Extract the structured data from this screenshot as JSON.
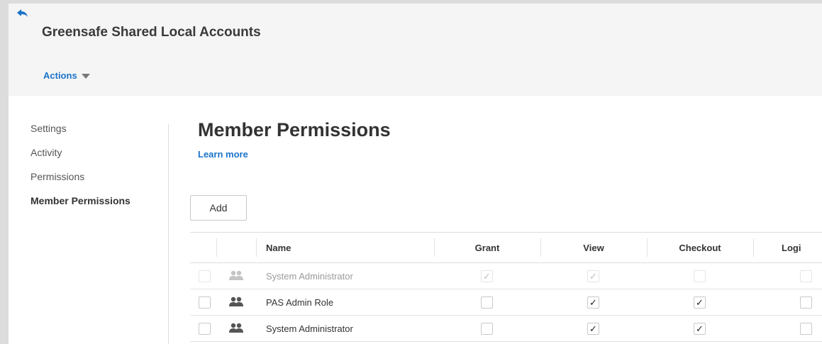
{
  "header": {
    "title": "Greensafe Shared Local Accounts",
    "actions_label": "Actions"
  },
  "sidebar": {
    "items": [
      {
        "label": "Settings",
        "active": false
      },
      {
        "label": "Activity",
        "active": false
      },
      {
        "label": "Permissions",
        "active": false
      },
      {
        "label": "Member Permissions",
        "active": true
      }
    ]
  },
  "main": {
    "title": "Member Permissions",
    "learn_more": "Learn more",
    "add_label": "Add"
  },
  "table": {
    "columns": [
      "Name",
      "Grant",
      "View",
      "Checkout",
      "Logi"
    ],
    "rows": [
      {
        "name": "System Administrator",
        "disabled": true,
        "grant": true,
        "view": true,
        "checkout": false,
        "login": false
      },
      {
        "name": "PAS Admin Role",
        "disabled": false,
        "grant": false,
        "view": true,
        "checkout": true,
        "login": false
      },
      {
        "name": "System Administrator",
        "disabled": false,
        "grant": false,
        "view": true,
        "checkout": true,
        "login": false
      }
    ]
  },
  "icons": {
    "back": "back-arrow-icon",
    "caret": "caret-down-icon",
    "row": "group-icon"
  },
  "colors": {
    "accent": "#1a73c8",
    "header_bg": "#f5f5f5"
  }
}
